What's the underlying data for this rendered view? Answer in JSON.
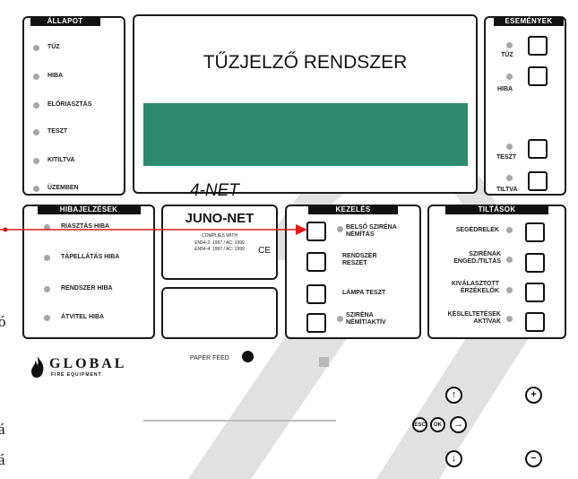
{
  "status_panel": {
    "title": "ÁLLAPOT",
    "items": [
      "TŰZ",
      "HIBA",
      "ELŐRIASZTÁS",
      "TESZT",
      "KITILTVA",
      "ÜZEMBEN"
    ]
  },
  "display": {
    "title": "TŰZJELZŐ RENDSZER",
    "brand": "4-NET",
    "lcd_color": "#2e8a6d"
  },
  "events_panel": {
    "title": "ESEMÉNYEK",
    "items": [
      "TŰZ",
      "HIBA",
      "TESZT",
      "TILTVA"
    ]
  },
  "faults_panel": {
    "title": "HIBAJELZÉSEK",
    "items": [
      "RIASZTÁS HIBA",
      "TÁPELLÁTÁS HIBA",
      "RENDSZER HIBA",
      "ÁTVITEL HIBA"
    ]
  },
  "juno": {
    "name": "JUNO-NET",
    "complies": "COMPLIES WITH",
    "std1": "EN54-2: 1997 / AC: 1999",
    "std2": "EN54-4: 1997 / AC: 1999",
    "ce": "CE"
  },
  "control_panel": {
    "title": "KEZELÉS",
    "items": [
      "BELSŐ SZIRÉNA NÉMÍTÁS",
      "RENDSZER RESZET",
      "LÁMPA TESZT",
      "SZIRÉNA NÉMÍT/AKTÍV"
    ]
  },
  "disable_panel": {
    "title": "TILTÁSOK",
    "items": [
      "SEGÉDRELÉK",
      "SZIRÉNÁK ENGED./TILTÁS",
      "KIVÁLASZTOTT ÉRZÉKELŐK",
      "KÉSLELTETÉSEK AKTÍVAK"
    ]
  },
  "printer": {
    "paper_feed": "PAPER FEED"
  },
  "logo": {
    "name": "GLOBAL",
    "sub": "FIRE EQUIPMENT"
  },
  "nav": {
    "esc": "ESC",
    "ok": "OK"
  },
  "side_text": [
    "ó",
    "á",
    "á"
  ],
  "colors": {
    "arrow": "#e01b1b",
    "watermark": "#d4d4d4"
  }
}
